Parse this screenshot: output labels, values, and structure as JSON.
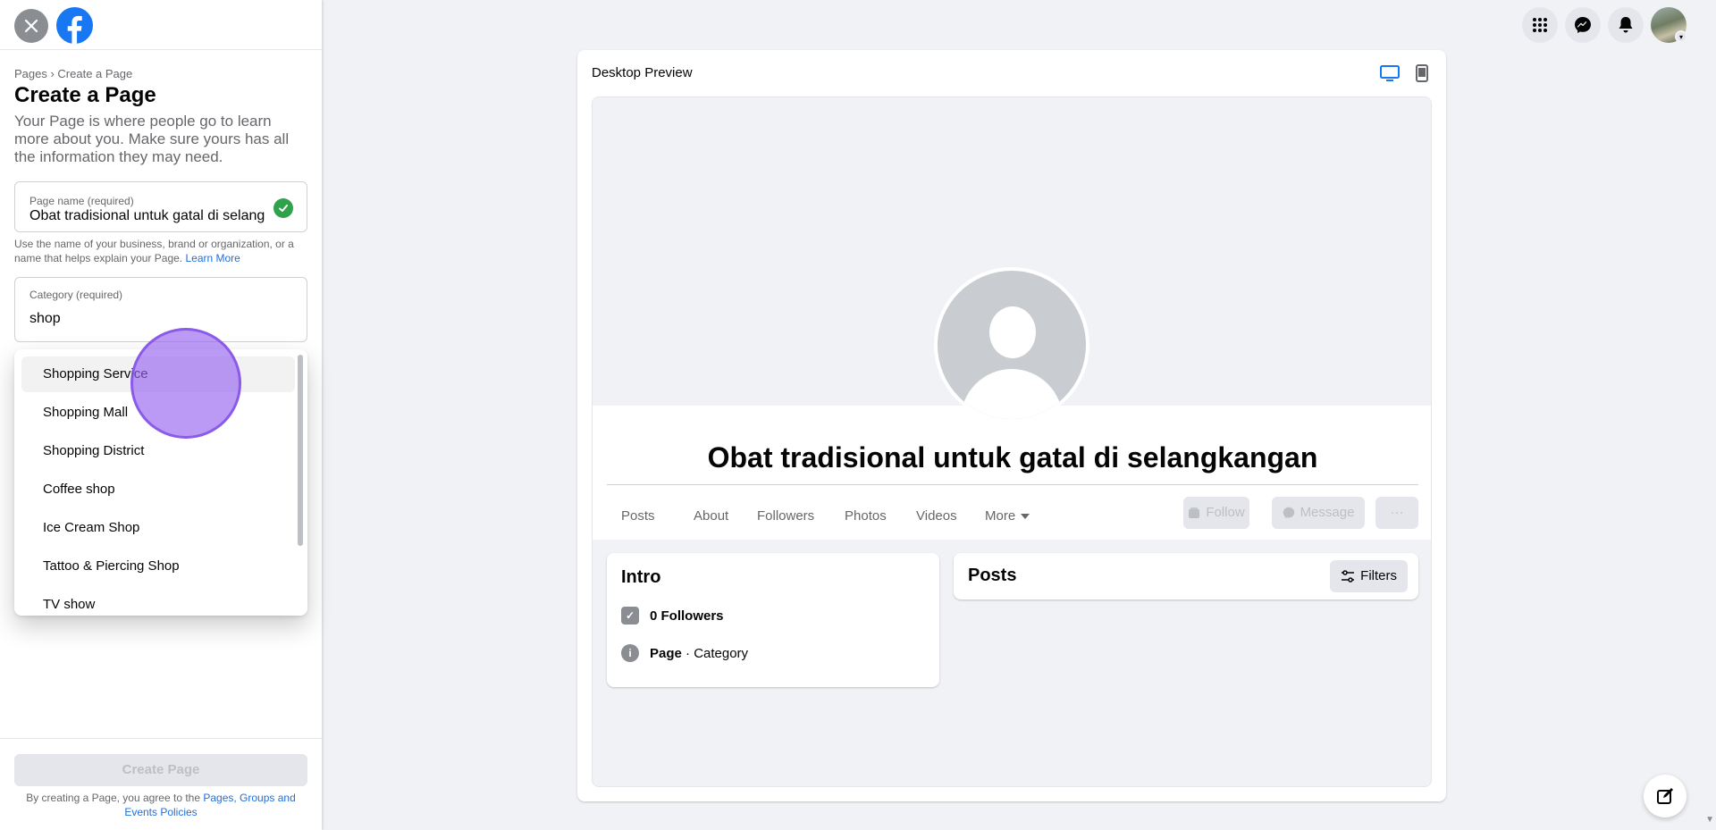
{
  "sidebar": {
    "breadcrumb": "Pages › Create a Page",
    "title": "Create a Page",
    "description": "Your Page is where people go to learn more about you. Make sure yours has all the information they may need.",
    "page_name": {
      "label": "Page name (required)",
      "value": "Obat tradisional untuk gatal di selang"
    },
    "hint": "Use the name of your business, brand or organization, or a name that helps explain your Page.",
    "hint_link": "Learn More",
    "category": {
      "label": "Category (required)",
      "value": "shop"
    },
    "dropdown_items": [
      "Shopping Service",
      "Shopping Mall",
      "Shopping District",
      "Coffee shop",
      "Ice Cream Shop",
      "Tattoo & Piercing Shop",
      "TV show"
    ],
    "create_button": "Create Page",
    "terms_prefix": "By creating a Page, you agree to the",
    "terms_link": "Pages, Groups and Events Policies"
  },
  "preview": {
    "title": "Desktop Preview",
    "page_name": "Obat tradisional untuk gatal di selangkangan",
    "tabs": [
      "Posts",
      "About",
      "Followers",
      "Photos",
      "Videos",
      "More"
    ],
    "follow_button": "Follow",
    "message_button": "Message",
    "more_button": "···",
    "intro": {
      "title": "Intro",
      "followers": "0 Followers",
      "page_bold": "Page",
      "category": " · Category"
    },
    "posts": {
      "title": "Posts",
      "filters": "Filters"
    }
  },
  "colors": {
    "brand": "#1877f2",
    "link": "#216fdb",
    "success": "#31a24c",
    "cursor_highlight": "#9664f0"
  },
  "icons": [
    "close-icon",
    "facebook-logo-icon",
    "menu-grid-icon",
    "messenger-icon",
    "bell-icon",
    "desktop-icon",
    "mobile-icon",
    "check-icon",
    "compose-icon"
  ]
}
